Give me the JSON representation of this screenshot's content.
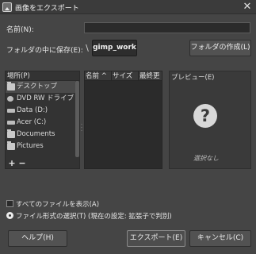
{
  "window": {
    "title": "画像をエクスポート",
    "close_glyph": "✕"
  },
  "name_field": {
    "label": "名前(N):",
    "value": ""
  },
  "save_in": {
    "label": "フォルダの中に保存(E):",
    "separator": "\\",
    "path_segment": "gimp_work",
    "create_folder_label": "フォルダの作成(L)"
  },
  "places": {
    "header": "場所(P)",
    "items": [
      {
        "label": "デスクトップ",
        "icon": "folder-icon",
        "selected": true
      },
      {
        "label": "DVD RW ドライブ",
        "icon": "disc-drive-icon"
      },
      {
        "label": "Data (D:)",
        "icon": "drive-icon"
      },
      {
        "label": "Acer (C:)",
        "icon": "drive-icon"
      },
      {
        "label": "Documents",
        "icon": "folder-icon"
      },
      {
        "label": "Pictures",
        "icon": "folder-icon"
      }
    ],
    "add_glyph": "+",
    "remove_glyph": "−"
  },
  "file_list": {
    "columns": [
      "名前 ^",
      "サイズ",
      "最終更"
    ]
  },
  "preview": {
    "title": "プレビュー(E)",
    "icon": "help-icon",
    "icon_glyph": "?",
    "empty_text": "選択なし"
  },
  "options": {
    "show_all_files": {
      "label": "すべてのファイルを表示(A)",
      "checked": false
    },
    "file_type": {
      "label": "ファイル形式の選択(T) (現在の設定: 拡張子で判別)",
      "selected": true
    }
  },
  "buttons": {
    "help": "ヘルプ(H)",
    "export": "エクスポート(E)",
    "cancel": "キャンセル(C)"
  },
  "colors": {
    "background": "#454545",
    "field": "#2b2b2b",
    "button": "#525252"
  }
}
